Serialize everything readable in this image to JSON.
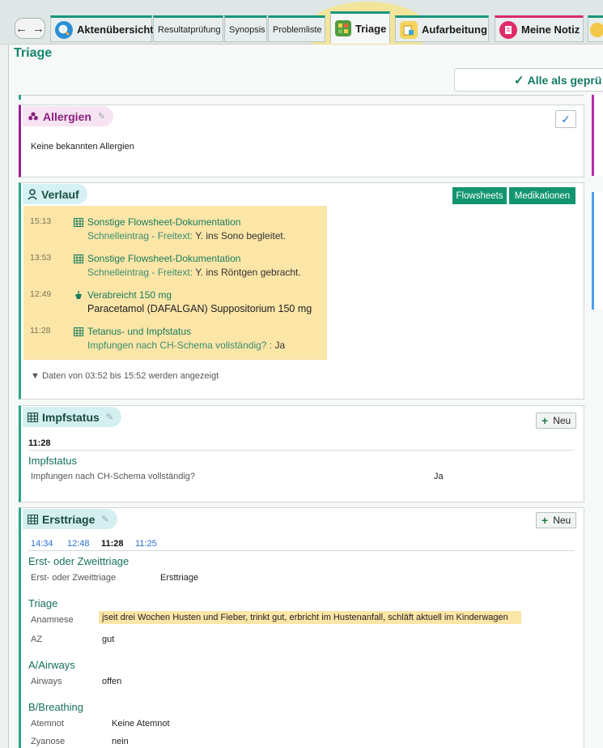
{
  "tabs": [
    {
      "label": "Aktenübersicht",
      "icon": "magnifier-icon"
    },
    {
      "label": "Resultatprüfung"
    },
    {
      "label": "Synopsis"
    },
    {
      "label": "Problemliste"
    },
    {
      "label": "Triage",
      "icon": "triage-icon"
    },
    {
      "label": "Aufarbeitung",
      "icon": "aufarbeitung-icon"
    },
    {
      "label": "Meine Notiz",
      "icon": "notiz-icon"
    }
  ],
  "nav": {
    "back": "←",
    "forward": "→"
  },
  "page": {
    "title": "Triage",
    "mark_all_label": "Alle als geprü"
  },
  "allergien": {
    "title": "Allergien",
    "text": "Keine bekannten Allergien"
  },
  "verlauf": {
    "title": "Verlauf",
    "buttons": {
      "flowsheets": "Flowsheets",
      "medikationen": "Medikationen"
    },
    "entries": [
      {
        "time": "15:13",
        "title": "Sonstige Flowsheet-Dokumentation",
        "sub_label": "Schnelleintrag - Freitext:",
        "sub_value": "Y. ins Sono begleitet."
      },
      {
        "time": "13:53",
        "title": "Sonstige Flowsheet-Dokumentation",
        "sub_label": "Schnelleintrag - Freitext:",
        "sub_value": "Y. ins Röntgen gebracht."
      },
      {
        "time": "12:49",
        "title": "Verabreicht 150 mg",
        "sub_value": "Paracetamol (DAFALGAN) Suppositorium 150 mg"
      },
      {
        "time": "11:28",
        "title": "Tetanus- und Impfstatus",
        "sub_label": "Impfungen nach CH-Schema vollständig? :",
        "sub_value": "Ja"
      }
    ],
    "filter_text": "Daten von 03:52 bis 15:52 werden angezeigt"
  },
  "impfstatus": {
    "title": "Impfstatus",
    "new_label": "Neu",
    "time": "11:28",
    "section": "Impfstatus",
    "row": {
      "label": "Impfungen nach CH-Schema vollständig?",
      "value": "Ja"
    }
  },
  "ersttriage": {
    "title": "Ersttriage",
    "new_label": "Neu",
    "times": [
      "14:34",
      "12:48",
      "11:28",
      "11:25"
    ],
    "sections": [
      {
        "title": "Erst- oder Zweittriage",
        "rows": [
          {
            "label": "Erst- oder Zweittriage",
            "value": "Ersttriage"
          }
        ]
      },
      {
        "title": "Triage",
        "rows": [
          {
            "label": "Anamnese",
            "value": "jseit drei Wochen Husten und Fieber, trinkt gut, erbricht im Hustenanfall, schläft aktuell im Kinderwagen"
          },
          {
            "label": "AZ",
            "value": "gut"
          }
        ]
      },
      {
        "title": "A/Airways",
        "rows": [
          {
            "label": "Airways",
            "value": "offen"
          }
        ]
      },
      {
        "title": "B/Breathing",
        "rows": [
          {
            "label": "Atemnot",
            "value": "Keine Atemnot"
          },
          {
            "label": "Zyanose",
            "value": "nein"
          }
        ]
      }
    ]
  },
  "colors": {
    "accent": "#17967c",
    "highlight": "#fbe5a7",
    "allergy": "#9b1f97"
  }
}
